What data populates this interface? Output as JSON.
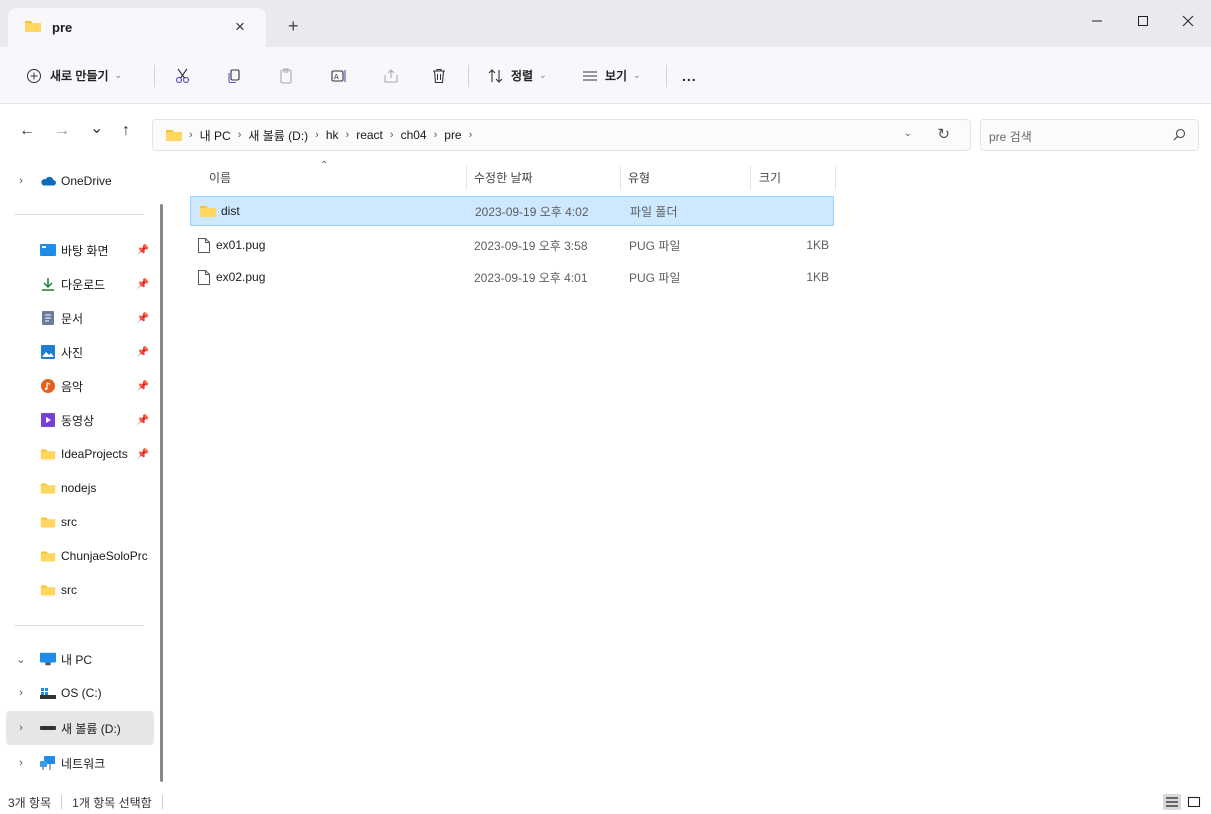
{
  "tab": {
    "title": "pre",
    "close": "×",
    "new": "+"
  },
  "window": {
    "minimize": "—",
    "maximize": "☐",
    "close": "✕"
  },
  "commands": {
    "new_label": "새로 만들기",
    "sort_label": "정렬",
    "view_label": "보기",
    "more_label": "..."
  },
  "nav": {
    "back": "←",
    "forward": "→",
    "recent": "⌄",
    "up": "↑",
    "breadcrumb": [
      "내 PC",
      "새 볼륨 (D:)",
      "hk",
      "react",
      "ch04",
      "pre"
    ],
    "search_placeholder": "pre 검색"
  },
  "sidebar": {
    "top": [
      {
        "label": "OneDrive",
        "icon": "cloud-icon"
      }
    ],
    "quick": [
      {
        "label": "바탕 화면",
        "icon": "desktop-icon",
        "pinned": true
      },
      {
        "label": "다운로드",
        "icon": "download-icon",
        "pinned": true
      },
      {
        "label": "문서",
        "icon": "document-icon",
        "pinned": true
      },
      {
        "label": "사진",
        "icon": "pictures-icon",
        "pinned": true
      },
      {
        "label": "음악",
        "icon": "music-icon",
        "pinned": true
      },
      {
        "label": "동영상",
        "icon": "video-icon",
        "pinned": true
      },
      {
        "label": "IdeaProjects",
        "icon": "folder-icon",
        "pinned": true
      },
      {
        "label": "nodejs",
        "icon": "folder-icon",
        "pinned": false
      },
      {
        "label": "src",
        "icon": "folder-icon",
        "pinned": false
      },
      {
        "label": "ChunjaeSoloPrc",
        "icon": "folder-icon",
        "pinned": false
      },
      {
        "label": "src",
        "icon": "folder-icon",
        "pinned": false
      }
    ],
    "pc": [
      {
        "label": "내 PC",
        "icon": "computer-icon"
      },
      {
        "label": "OS (C:)",
        "icon": "drive-icon"
      },
      {
        "label": "새 볼륨 (D:)",
        "icon": "drive-icon"
      },
      {
        "label": "네트워크",
        "icon": "network-icon"
      }
    ]
  },
  "columns": {
    "name": "이름",
    "date": "수정한 날짜",
    "type": "유형",
    "size": "크기"
  },
  "files": [
    {
      "name": "dist",
      "date": "2023-09-19 오후 4:02",
      "type": "파일 폴더",
      "size": "",
      "kind": "folder",
      "selected": true
    },
    {
      "name": "ex01.pug",
      "date": "2023-09-19 오후 3:58",
      "type": "PUG 파일",
      "size": "1KB",
      "kind": "file",
      "selected": false
    },
    {
      "name": "ex02.pug",
      "date": "2023-09-19 오후 4:01",
      "type": "PUG 파일",
      "size": "1KB",
      "kind": "file",
      "selected": false
    }
  ],
  "status": {
    "count": "3개 항목",
    "selection": "1개 항목 선택함"
  },
  "colors": {
    "folder": "#f4c430",
    "selection_bg": "#cde8ff",
    "selection_border": "#99d1ff",
    "titlebar": "#ebe8ef"
  }
}
